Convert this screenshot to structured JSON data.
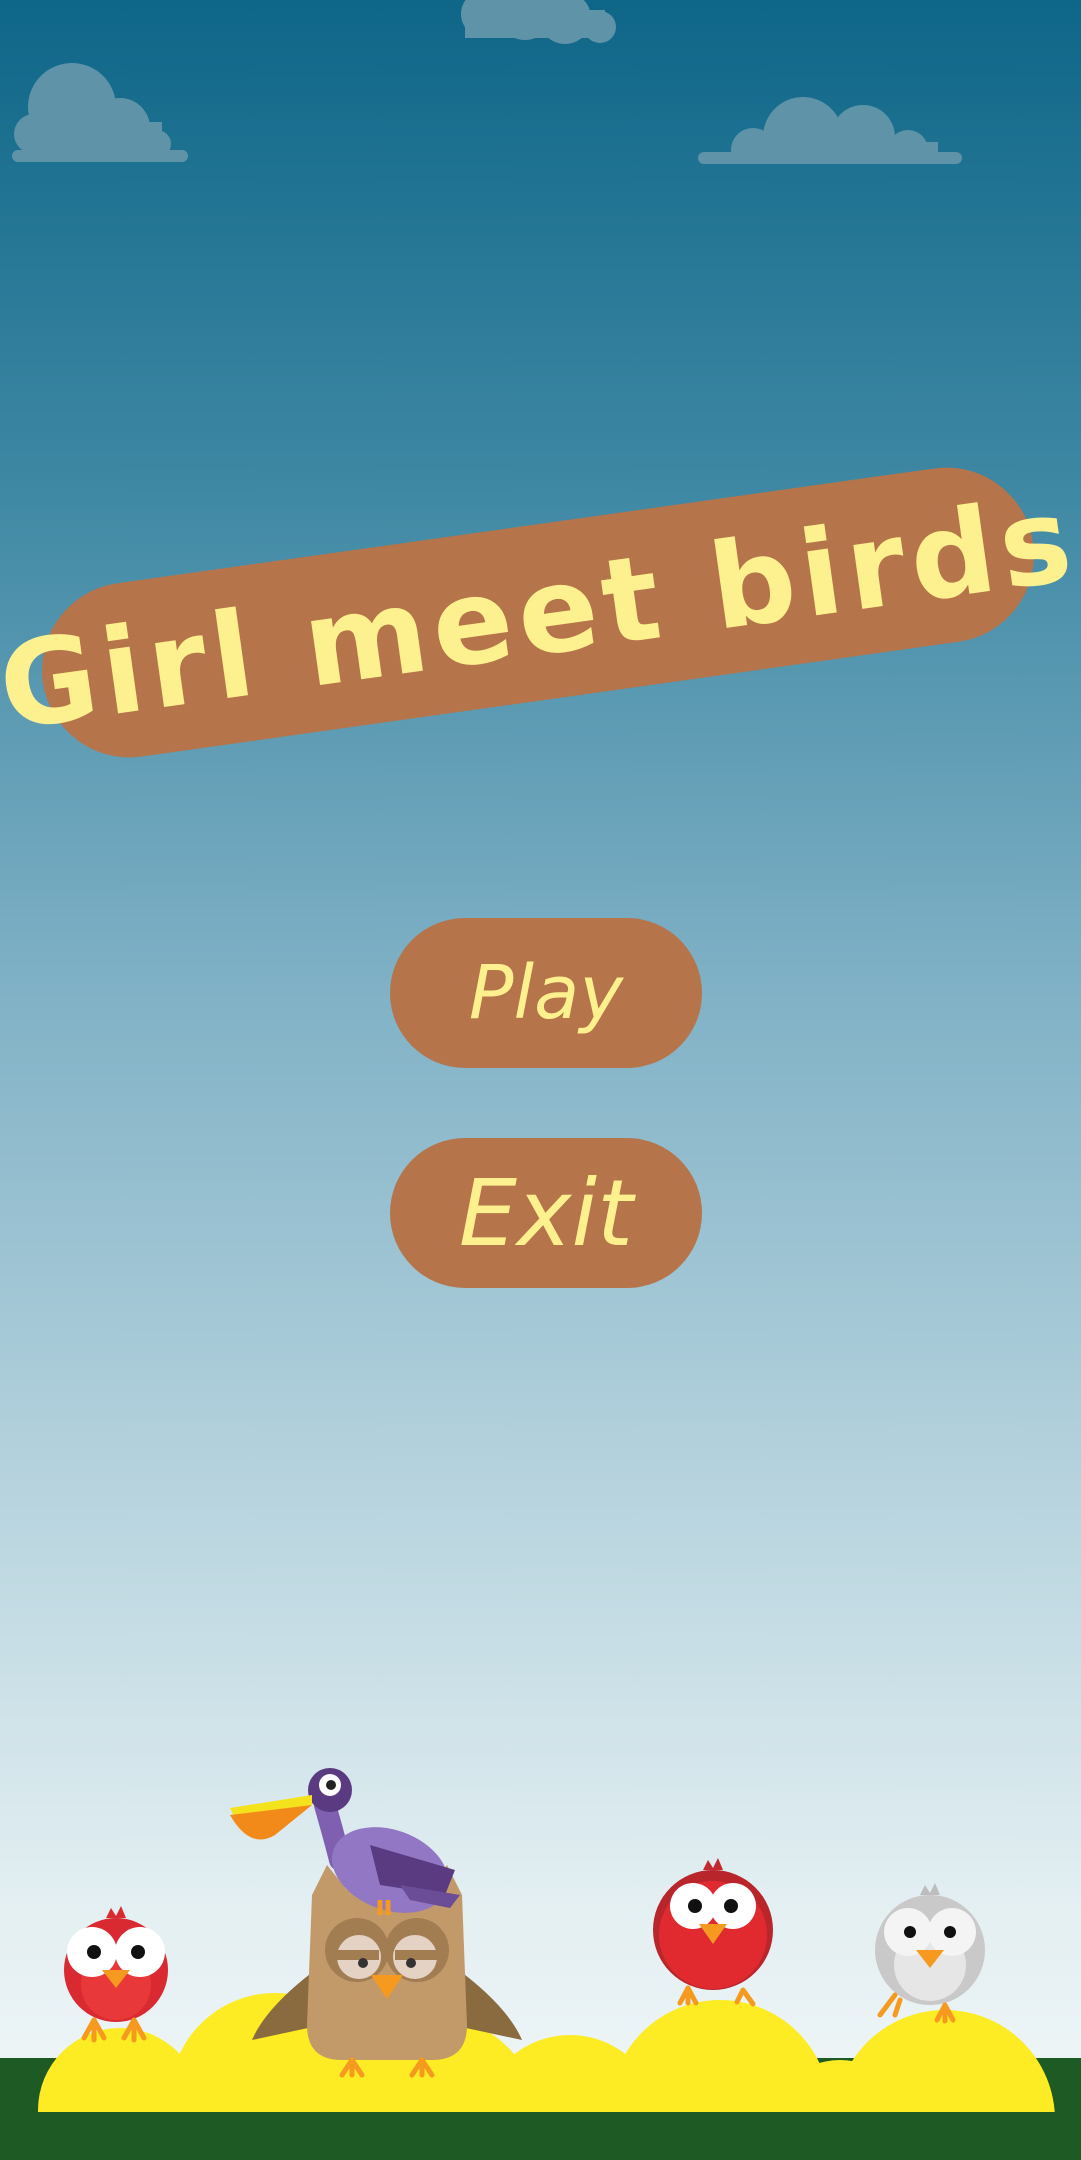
{
  "title": "Girl meet birds",
  "menu": {
    "play_label": "Play",
    "exit_label": "Exit"
  },
  "colors": {
    "sky_top": "#0e6688",
    "sky_bottom": "#f2f7f8",
    "banner": "#b5744a",
    "text": "#fdf08e",
    "cloud": "#5f93a8",
    "grass": "#1e5a24",
    "hills": "#fdeb24"
  },
  "characters": [
    "red-bird",
    "owl",
    "pelican",
    "red-bird",
    "gray-bird"
  ]
}
